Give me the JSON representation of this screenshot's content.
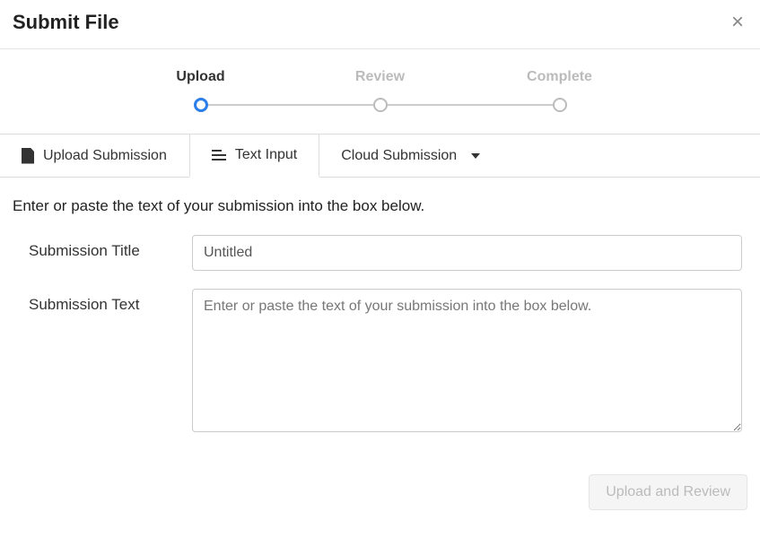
{
  "header": {
    "title": "Submit File",
    "close": "×"
  },
  "stepper": {
    "steps": [
      {
        "label": "Upload",
        "active": true
      },
      {
        "label": "Review",
        "active": false
      },
      {
        "label": "Complete",
        "active": false
      }
    ]
  },
  "tabs": {
    "upload": "Upload Submission",
    "text_input": "Text Input",
    "cloud": "Cloud Submission",
    "active": "text_input"
  },
  "form": {
    "instruction": "Enter or paste the text of your submission into the box below.",
    "title_label": "Submission Title",
    "title_value": "Untitled",
    "text_label": "Submission Text",
    "text_placeholder": "Enter or paste the text of your submission into the box below."
  },
  "footer": {
    "submit_label": "Upload and Review"
  }
}
